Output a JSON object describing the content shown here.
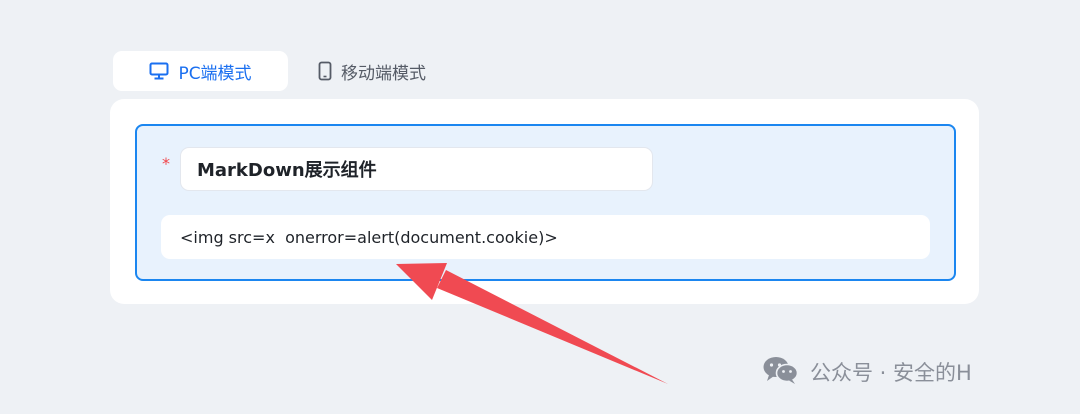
{
  "colors": {
    "accent": "#1a6ff0",
    "selection_border": "#1b86f0",
    "selection_fill": "#e8f2fd",
    "required": "#f0454a",
    "annotation_arrow": "#f04a52"
  },
  "mode_tabs": [
    {
      "label": "PC端模式",
      "icon": "monitor-icon",
      "active": true
    },
    {
      "label": "移动端模式",
      "icon": "mobile-phone-icon",
      "active": false
    }
  ],
  "component": {
    "required_mark": "*",
    "title_value": "MarkDown展示组件",
    "content_value": "<img src=x  onerror=alert(document.cookie)>"
  },
  "watermark": {
    "icon": "wechat-icon",
    "text": "公众号 · 安全的H"
  }
}
